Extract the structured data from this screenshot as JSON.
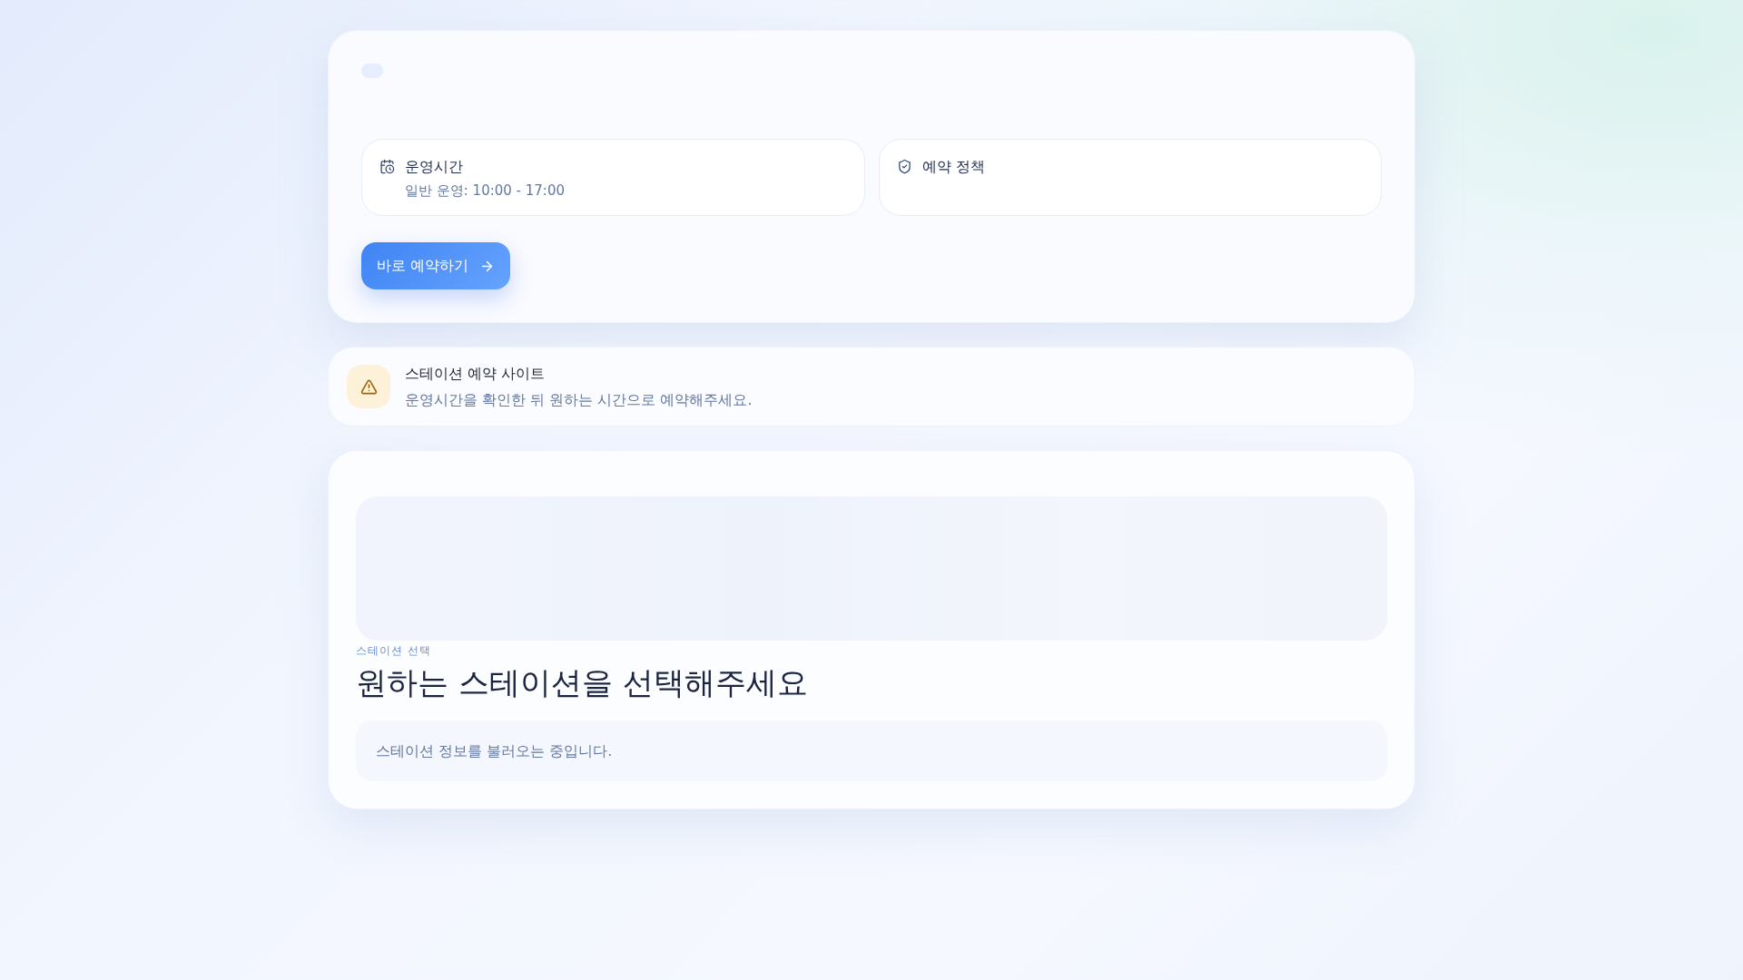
{
  "hero": {
    "info_cards": [
      {
        "kind": "hours",
        "title": "운영시간",
        "detail": "일반 운영: 10:00 - 17:00"
      },
      {
        "kind": "policy",
        "title": "예약 정책"
      }
    ],
    "button": "바로 예약하기"
  },
  "notice": {
    "title": "스테이션 예약 사이트",
    "message": "운영시간을 확인한 뒤 원하는 시간으로 예약해주세요."
  },
  "stations": {
    "eyebrow": "스테이션 선택",
    "heading": "원하는 스테이션을 선택해주세요",
    "status": "스테이션 정보를 불러오는 중입니다."
  }
}
